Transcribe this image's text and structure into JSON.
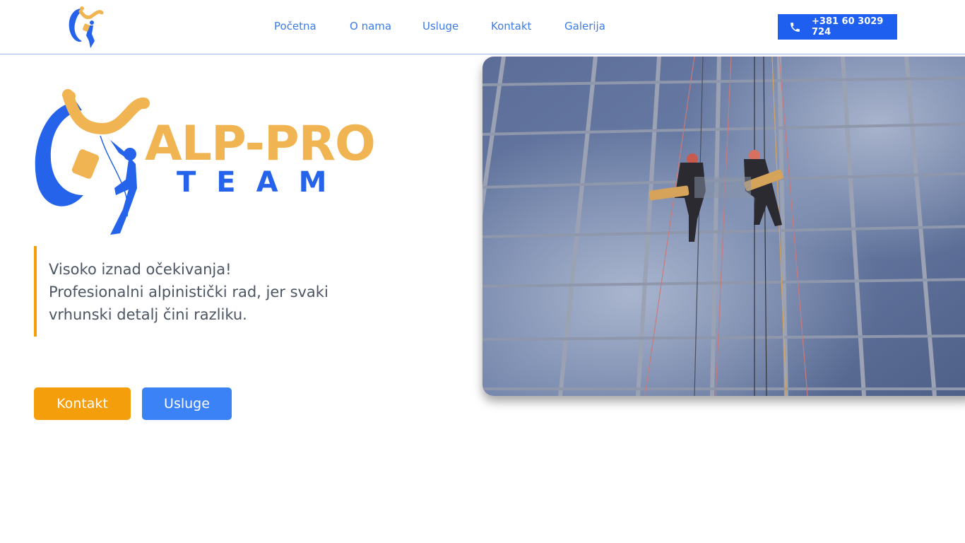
{
  "header": {
    "logo_icon": "alp-pro-logo-mark",
    "nav": [
      {
        "label": "Početna"
      },
      {
        "label": "O nama"
      },
      {
        "label": "Usluge"
      },
      {
        "label": "Kontakt"
      },
      {
        "label": "Galerija"
      }
    ],
    "phone": {
      "icon": "phone-icon",
      "label": "+381 60 3029 724"
    }
  },
  "hero": {
    "brand_name": "ALP-PRO",
    "brand_sub": "TEAM",
    "tagline": "Visoko iznad očekivanja! Profesionalni alpinistički rad, jer svaki vrhunski detalj čini razliku.",
    "buttons": {
      "kontakt": "Kontakt",
      "usluge": "Usluge"
    },
    "image": "rope-access-window-cleaners-on-glass-facade"
  },
  "colors": {
    "primary_blue": "#2563eb",
    "accent_orange": "#f59e0b",
    "logo_gold": "#f0b552"
  }
}
